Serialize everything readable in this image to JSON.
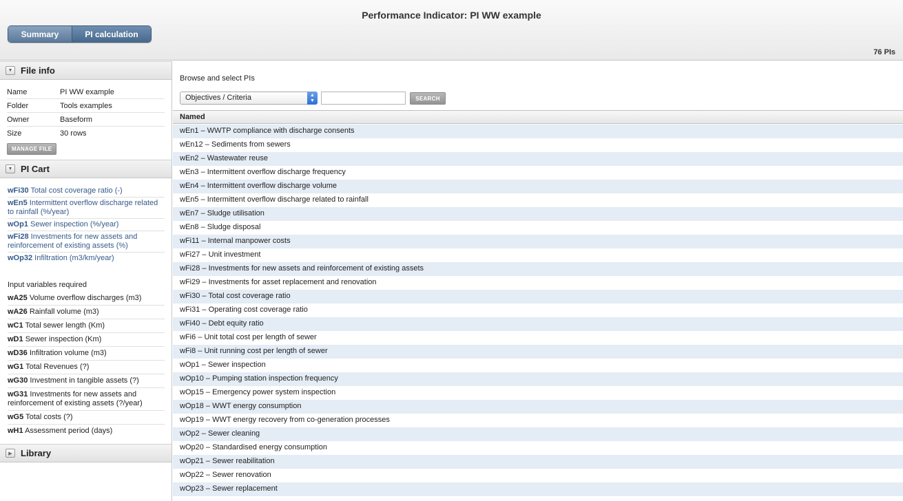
{
  "header": {
    "title": "Performance Indicator: PI WW example",
    "tabs": [
      "Summary",
      "PI calculation"
    ],
    "pi_count": "76 PIs"
  },
  "sidebar": {
    "file_info": {
      "title": "File info",
      "rows": [
        {
          "key": "Name",
          "value": "PI WW example"
        },
        {
          "key": "Folder",
          "value": "Tools examples"
        },
        {
          "key": "Owner",
          "value": "Baseform"
        },
        {
          "key": "Size",
          "value": "30 rows"
        }
      ],
      "manage_button": "MANAGE FILE"
    },
    "pi_cart": {
      "title": "PI Cart",
      "items": [
        {
          "code": "wFi30",
          "label": "Total cost coverage ratio (-)"
        },
        {
          "code": "wEn5",
          "label": "Intermittent overflow discharge related to rainfall (%/year)"
        },
        {
          "code": "wOp1",
          "label": "Sewer inspection (%/year)"
        },
        {
          "code": "wFi28",
          "label": "Investments for new assets and reinforcement of existing assets (%)"
        },
        {
          "code": "wOp32",
          "label": "Infiltration (m3/km/year)"
        }
      ],
      "required_title": "Input variables required",
      "variables": [
        {
          "code": "wA25",
          "label": "Volume overflow discharges (m3)"
        },
        {
          "code": "wA26",
          "label": "Rainfall volume (m3)"
        },
        {
          "code": "wC1",
          "label": "Total sewer length (Km)"
        },
        {
          "code": "wD1",
          "label": "Sewer inspection (Km)"
        },
        {
          "code": "wD36",
          "label": "Infiltration volume (m3)"
        },
        {
          "code": "wG1",
          "label": "Total Revenues (?)"
        },
        {
          "code": "wG30",
          "label": "Investment in tangible assets (?)"
        },
        {
          "code": "wG31",
          "label": "Investments for new assets and reinforcement of existing assets (?/year)"
        },
        {
          "code": "wG5",
          "label": "Total costs (?)"
        },
        {
          "code": "wH1",
          "label": "Assessment period (days)"
        }
      ]
    },
    "library": {
      "title": "Library"
    }
  },
  "main": {
    "browse_title": "Browse and select PIs",
    "select_value": "Objectives / Criteria",
    "search_placeholder": "",
    "search_button": "SEARCH",
    "column_header": "Named",
    "rows": [
      "wEn1 – WWTP compliance with discharge consents",
      "wEn12 – Sediments from sewers",
      "wEn2 – Wastewater reuse",
      "wEn3 – Intermittent overflow discharge frequency",
      "wEn4 – Intermittent overflow discharge volume",
      "wEn5 – Intermittent overflow discharge related to rainfall",
      "wEn7 – Sludge utilisation",
      "wEn8 – Sludge disposal",
      "wFi11 – Internal manpower costs",
      "wFi27 – Unit investment",
      "wFi28 – Investments for new assets and reinforcement of existing assets",
      "wFi29 – Investments for asset replacement and renovation",
      "wFi30 – Total cost coverage ratio",
      "wFi31 – Operating cost coverage ratio",
      "wFi40 – Debt equity ratio",
      "wFi6 – Unit total cost per length of sewer",
      "wFi8 – Unit running cost per length of sewer",
      "wOp1 – Sewer inspection",
      "wOp10 – Pumping station inspection frequency",
      "wOp15 – Emergency power system inspection",
      "wOp18 – WWT energy consumption",
      "wOp19 – WWT energy recovery from co-generation processes",
      "wOp2 – Sewer cleaning",
      "wOp20 – Standardised energy consumption",
      "wOp21 – Sewer reabilitation",
      "wOp22 – Sewer renovation",
      "wOp23 – Sewer replacement"
    ]
  }
}
